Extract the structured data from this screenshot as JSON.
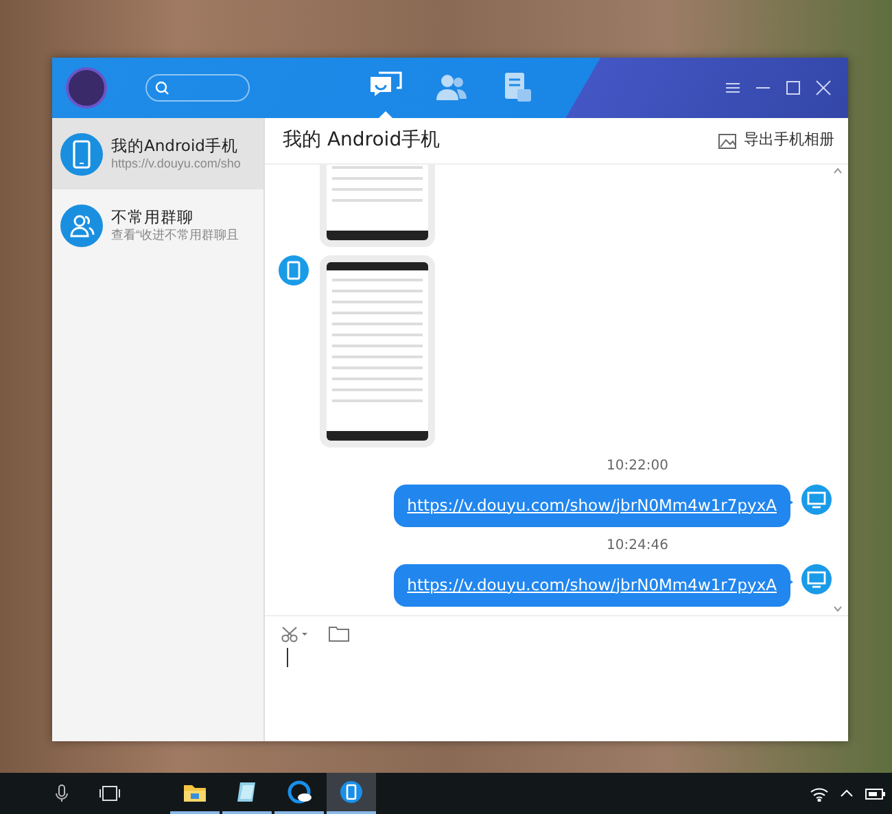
{
  "window": {
    "tabs": [
      {
        "kind": "chat",
        "selected": true
      },
      {
        "kind": "contacts",
        "selected": false
      },
      {
        "kind": "files",
        "selected": false
      }
    ]
  },
  "sidebar": {
    "items": [
      {
        "kind": "phone",
        "title": "我的Android手机",
        "subtitle": "https://v.douyu.com/sho",
        "selected": true
      },
      {
        "kind": "group",
        "title": "不常用群聊",
        "subtitle": "查看“收进不常用群聊且",
        "selected": false
      }
    ]
  },
  "chat": {
    "title": "我的 Android手机",
    "export_label": "导出手机相册",
    "messages": [
      {
        "kind": "image",
        "outgoing": false
      },
      {
        "kind": "image",
        "outgoing": false
      },
      {
        "kind": "time",
        "text": "10:22:00"
      },
      {
        "kind": "link",
        "outgoing": true,
        "text": "https://v.douyu.com/show/jbrN0Mm4w1r7pyxA"
      },
      {
        "kind": "time",
        "text": "10:24:46"
      },
      {
        "kind": "link",
        "outgoing": true,
        "text": "https://v.douyu.com/show/jbrN0Mm4w1r7pyxA"
      }
    ]
  },
  "taskbar": {
    "apps": [
      {
        "kind": "folder",
        "running": true,
        "selected": false
      },
      {
        "kind": "notes",
        "running": true,
        "selected": false
      },
      {
        "kind": "cloud",
        "running": true,
        "selected": false
      },
      {
        "kind": "phone",
        "running": true,
        "selected": true
      }
    ]
  }
}
